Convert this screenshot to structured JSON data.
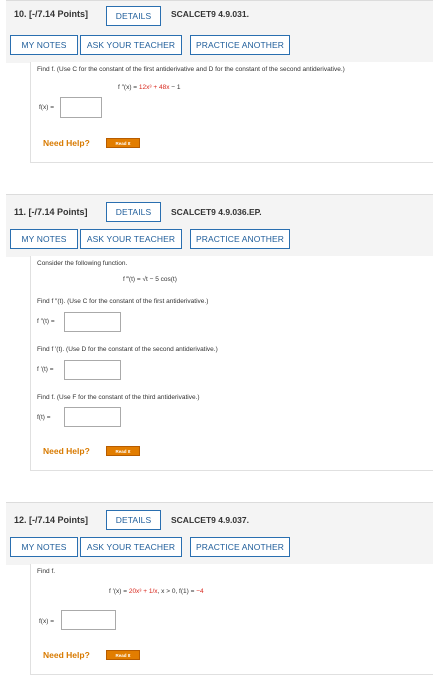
{
  "common": {
    "details_label": "DETAILS",
    "my_notes_label": "MY NOTES",
    "ask_teacher_label": "ASK YOUR TEACHER",
    "practice_label": "PRACTICE ANOTHER",
    "need_help_label": "Need Help?",
    "read_it_label": "Read It"
  },
  "q10": {
    "points": "10.  [-/7.14 Points]",
    "code": "SCALCET9 4.9.031.",
    "instruction": "Find f.  (Use C for the constant of the first antiderivative and D for the constant of the second antiderivative.)",
    "eq_lhs": "f ″(x) = ",
    "eq_rhs_red": "12x³ + 48x",
    "eq_rhs_tail": " − 1",
    "answer_label": "f(x) =",
    "answer_value": ""
  },
  "q11": {
    "points": "11.  [-/7.14 Points]",
    "code": "SCALCET9 4.9.036.EP.",
    "intro": "Consider the following function.",
    "eq": "f ‴(t) = √t − 5 cos(t)",
    "prompt_a": "Find f ″(t). (Use C for the constant of the first antiderivative.)",
    "label_a": "f ″(t) =",
    "prompt_b": "Find f ′(t). (Use D for the constant of the second antiderivative.)",
    "label_b": "f ′(t) =",
    "prompt_c": "Find f. (Use F for the constant of the third antiderivative.)",
    "label_c": "f(t) =",
    "value_a": "",
    "value_b": "",
    "value_c": ""
  },
  "q12": {
    "points": "12.  [-/7.14 Points]",
    "code": "SCALCET9 4.9.037.",
    "intro": "Find f.",
    "eq_lhs": "f ′(x) = ",
    "eq_red": "20x³ + 1/x",
    "eq_cond": ",   x > 0,   f(1) = ",
    "eq_cond_red": "−4",
    "answer_label": "f(x) =",
    "answer_value": ""
  },
  "colors": {
    "button_border": "#2a6fb0",
    "button_text": "#1e5d9a",
    "need_help": "#d87a00",
    "read_it_bg": "#e27d00",
    "equation_red": "#d9281e"
  }
}
